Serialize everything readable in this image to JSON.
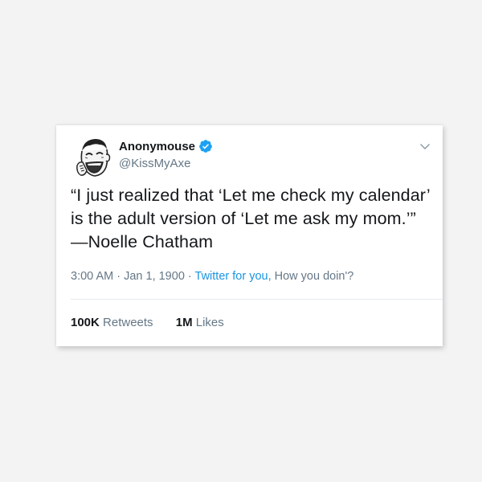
{
  "tweet": {
    "author": {
      "display_name": "Anonymouse",
      "handle": "@KissMyAxe",
      "verified": true
    },
    "text": "“I just realized that ‘Let me check my calendar’ is the adult version of ‘Let me ask my mom.’” —Noelle Chatham",
    "time": "3:00 AM",
    "separator": " · ",
    "date": "Jan 1, 1900",
    "source_app": "Twitter for you",
    "source_comma": ", ",
    "source_extra": "How you doin'?",
    "stats": {
      "retweets_count": "100K",
      "retweets_label": "Retweets",
      "likes_count": "1M",
      "likes_label": "Likes"
    }
  },
  "icons": {
    "verified": "verified-badge-icon",
    "menu": "chevron-down-icon",
    "avatar": "meme-face-avatar"
  },
  "colors": {
    "verified_blue": "#1da1f2",
    "link_blue": "#1b95e0",
    "secondary_text": "#657786",
    "primary_text": "#14171a"
  }
}
